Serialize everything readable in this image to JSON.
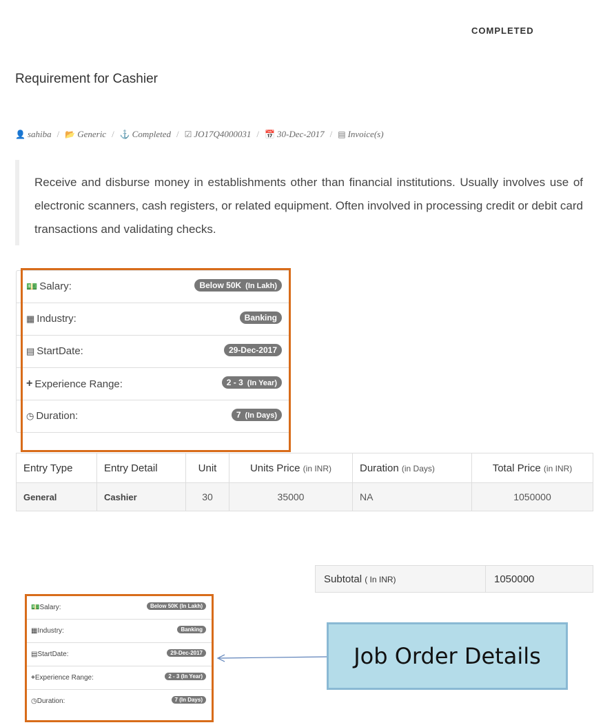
{
  "status": "COMPLETED",
  "title": "Requirement for Cashier",
  "meta": {
    "user": "sahiba",
    "category": "Generic",
    "state": "Completed",
    "job_id": "JO17Q4000031",
    "date": "30-Dec-2017",
    "invoice": "Invoice(s)"
  },
  "description": "Receive and disburse money in establishments other than financial institutions. Usually involves use of electronic scanners, cash registers, or related equipment. Often involved in processing credit or debit card transactions and validating checks.",
  "details": [
    {
      "icon": "money-icon",
      "label": "Salary:",
      "value": "Below 50K",
      "unit": "(In Lakh)"
    },
    {
      "icon": "building-icon",
      "label": "Industry:",
      "value": "Banking",
      "unit": ""
    },
    {
      "icon": "calendar-card-icon",
      "label": "StartDate:",
      "value": "29-Dec-2017",
      "unit": ""
    },
    {
      "icon": "plus-icon",
      "label": "Experience Range:",
      "value": "2 - 3",
      "unit": "(In Year)"
    },
    {
      "icon": "clock-icon",
      "label": "Duration:",
      "value": "7",
      "unit": "(In Days)"
    }
  ],
  "table": {
    "headers": [
      {
        "main": "Entry Type",
        "small": ""
      },
      {
        "main": "Entry Detail",
        "small": ""
      },
      {
        "main": "Unit",
        "small": ""
      },
      {
        "main": "Units Price",
        "small": "(in INR)"
      },
      {
        "main": "Duration",
        "small": "(in Days)"
      },
      {
        "main": "Total Price",
        "small": "(in INR)"
      }
    ],
    "rows": [
      [
        "General",
        "Cashier",
        "30",
        "35000",
        "NA",
        "1050000"
      ]
    ]
  },
  "subtotal": {
    "label": "Subtotal",
    "unit": "( In INR)",
    "value": "1050000"
  },
  "callout": "Job Order Details",
  "colors": {
    "highlight": "#d86c1a",
    "callout_bg": "#b4dce9",
    "badge": "#777777"
  }
}
